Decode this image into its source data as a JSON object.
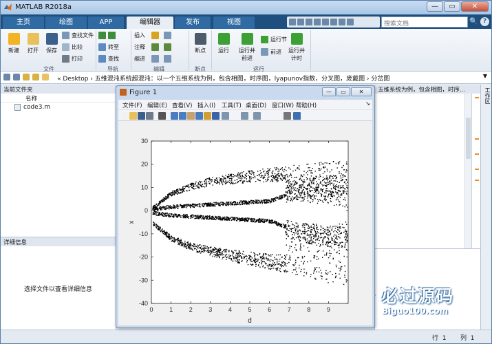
{
  "app": {
    "title": "MATLAB R2018a",
    "window_controls": {
      "minimize": "—",
      "maximize": "▭",
      "close": "✕"
    }
  },
  "tabs": [
    {
      "label": "主页",
      "active": false
    },
    {
      "label": "绘图",
      "active": false
    },
    {
      "label": "APP",
      "active": false
    },
    {
      "label": "编辑器",
      "active": true
    },
    {
      "label": "发布",
      "active": false
    },
    {
      "label": "视图",
      "active": false
    }
  ],
  "search": {
    "placeholder": "搜索文档",
    "search_icon": "🔍",
    "help_icon": "?"
  },
  "ribbon": {
    "file": {
      "new": "新建",
      "open": "打开",
      "save": "保存",
      "find_files": "查找文件",
      "compare": "比较",
      "print": "打印",
      "group_label": "文件"
    },
    "navigate": {
      "goto": "转至",
      "find": "查找",
      "group_label": "导航"
    },
    "edit": {
      "insert": "插入",
      "comment": "注释",
      "indent": "缩进",
      "group_label": "编辑"
    },
    "breakpoints": {
      "breakpoints": "断点",
      "group_label": "断点"
    },
    "run": {
      "run": "运行",
      "run_advance": "运行并\n前进",
      "run_section": "运行节",
      "advance": "前进",
      "run_time": "运行并\n计时",
      "group_label": "运行"
    }
  },
  "address": {
    "path": "« Desktop › 五维混沌系统超混沌：以一个五维系统为例，包含相图，时序图，lyapunov指数，分叉图，庞戴图 › 分岔图"
  },
  "current_folder": {
    "header": "当前文件夹",
    "column_name": "名称",
    "files": [
      "code3.m"
    ]
  },
  "details": {
    "header": "详细信息",
    "message": "选择文件以查看详细信息"
  },
  "editor": {
    "header": "五维系统为例，包含相图，时序..."
  },
  "sidebar_strip": {
    "label": "工作区"
  },
  "status": {
    "row_label": "行",
    "row_value": "1",
    "col_label": "列",
    "col_value": "1"
  },
  "watermark": {
    "brand": "必过源码",
    "url": "Biguo100.com"
  },
  "figure": {
    "title": "Figure 1",
    "menu": [
      "文件(F)",
      "编辑(E)",
      "查看(V)",
      "插入(I)",
      "工具(T)",
      "桌面(D)",
      "窗口(W)",
      "帮助(H)"
    ],
    "toolbar_icons": [
      "new-figure-icon",
      "open-icon",
      "save-icon",
      "print-icon",
      "pointer-icon",
      "zoom-in-icon",
      "zoom-out-icon",
      "pan-icon",
      "rotate-icon",
      "data-cursor-icon",
      "brush-icon",
      "link-icon",
      "colorbar-icon",
      "legend-icon",
      "hide-plot-tools-icon",
      "show-plot-tools-icon"
    ]
  },
  "chart_data": {
    "type": "scatter",
    "title": "",
    "xlabel": "d",
    "ylabel": "x",
    "xlim": [
      0,
      10
    ],
    "ylim": [
      -40,
      30
    ],
    "xticks": [
      0,
      1,
      2,
      3,
      4,
      5,
      6,
      7,
      8,
      9
    ],
    "yticks": [
      30,
      20,
      10,
      0,
      -10,
      -20,
      -30,
      -40
    ],
    "grid": false,
    "legend": "none",
    "marker_color": "#000000",
    "description_of_branches": [
      {
        "name": "upper",
        "x": [
          0.05,
          1,
          2,
          3,
          4,
          5,
          6,
          7,
          8,
          9,
          10
        ],
        "y": [
          2,
          8.5,
          12,
          14.5,
          16,
          17.5,
          18.5,
          19.5,
          20.5,
          21.5,
          22
        ]
      },
      {
        "name": "middle-upper",
        "x": [
          0.05,
          1,
          2,
          3,
          4,
          5,
          6,
          7,
          8,
          9,
          10
        ],
        "y": [
          0.5,
          1.5,
          2,
          2.5,
          3,
          3.5,
          4,
          7,
          8,
          9,
          9.5
        ]
      },
      {
        "name": "middle-lower",
        "x": [
          0.05,
          1,
          2,
          3,
          4,
          5,
          6,
          7,
          8,
          9,
          10
        ],
        "y": [
          -0.5,
          -1.5,
          -2,
          -2.5,
          -3,
          -3.5,
          -4,
          -7,
          -8,
          -9,
          -9.5
        ]
      },
      {
        "name": "lower",
        "x": [
          0.05,
          1,
          2,
          3,
          4,
          5,
          6,
          7,
          8,
          9,
          10
        ],
        "y": [
          -6,
          -13,
          -17,
          -19.5,
          -21.5,
          -23.5,
          -25,
          -27,
          -29,
          -31,
          -33
        ]
      }
    ]
  }
}
